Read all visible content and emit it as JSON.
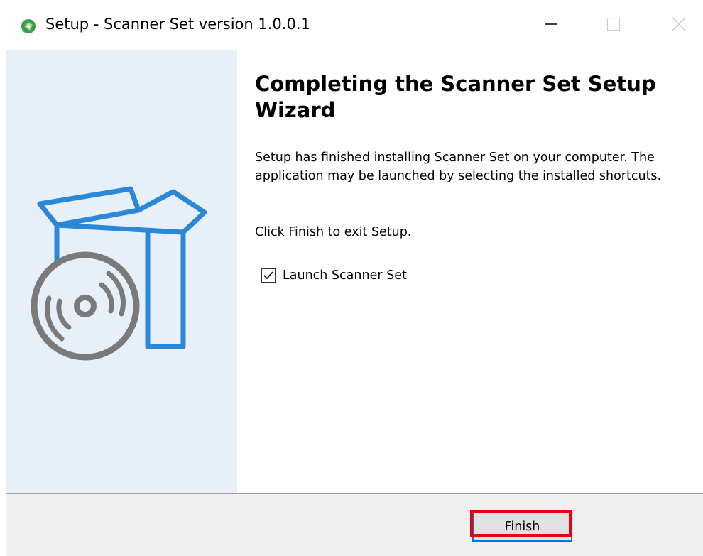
{
  "window": {
    "title": "Setup - Scanner Set version 1.0.0.1",
    "app_icon": "scanner-set-app-icon",
    "controls": {
      "minimize_icon": "minimize-icon",
      "maximize_icon": "maximize-icon",
      "close_icon": "close-icon"
    }
  },
  "side_panel": {
    "graphic": "software-box-with-disc-icon",
    "background_color": "#e7f0f8",
    "box_color": "#2b88d8",
    "disc_color": "#7a7a7a"
  },
  "content": {
    "heading": "Completing the Scanner Set Setup Wizard",
    "paragraph_1": "Setup has finished installing Scanner Set on your computer. The application may be launched by selecting the installed shortcuts.",
    "paragraph_2": "Click Finish to exit Setup.",
    "launch_checkbox": {
      "label": "Launch Scanner Set",
      "checked": true
    }
  },
  "footer": {
    "finish_label": "Finish",
    "highlight_color": "#e8000b",
    "focus_color": "#0078d7"
  }
}
